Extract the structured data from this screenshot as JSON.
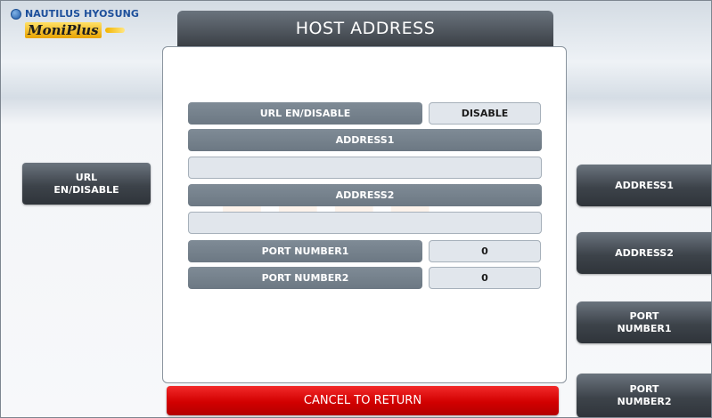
{
  "logo": {
    "brand": "NAUTILUS HYOSUNG",
    "product": "MoniPlus",
    "icon": "globe-logo-icon"
  },
  "screen": {
    "title": "HOST ADDRESS"
  },
  "form": {
    "url_label": "URL EN/DISABLE",
    "url_value": "DISABLE",
    "address1_label": "ADDRESS1",
    "address1_value": "",
    "address2_label": "ADDRESS2",
    "address2_value": "",
    "port1_label": "PORT NUMBER1",
    "port1_value": "0",
    "port2_label": "PORT NUMBER2",
    "port2_value": "0"
  },
  "side_buttons": {
    "url_toggle": "URL\nEN/DISABLE",
    "address1": "ADDRESS1",
    "address2": "ADDRESS2",
    "port1": "PORT\nNUMBER1",
    "port2": "PORT\nNUMBER2"
  },
  "cancel_label": "CANCEL TO RETURN",
  "colors": {
    "title_bg": "#3b4046",
    "label_bg": "#6c7883",
    "value_bg": "#e1e6ec",
    "cancel_bg": "#d20000"
  }
}
